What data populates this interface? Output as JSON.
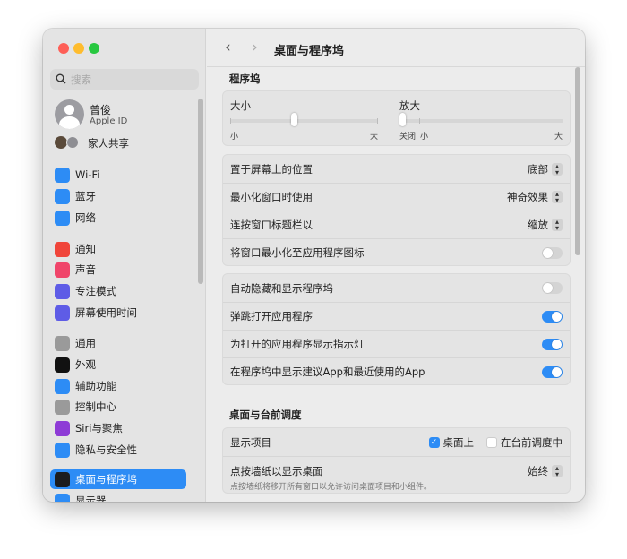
{
  "window": {
    "title": "桌面与程序坞"
  },
  "sidebar": {
    "search_placeholder": "搜索",
    "profile": {
      "name": "曾俊",
      "sub": "Apple ID"
    },
    "family": "家人共享",
    "items": [
      {
        "label": "Wi-Fi",
        "icon": "wifi-icon",
        "color": "#2d8cf5"
      },
      {
        "label": "蓝牙",
        "icon": "bluetooth-icon",
        "color": "#2d8cf5"
      },
      {
        "label": "网络",
        "icon": "globe-icon",
        "color": "#2d8cf5"
      },
      {
        "label": "通知",
        "icon": "bell-icon",
        "color": "#f0453a"
      },
      {
        "label": "声音",
        "icon": "speaker-icon",
        "color": "#f0456a"
      },
      {
        "label": "专注模式",
        "icon": "moon-icon",
        "color": "#5e5ce6"
      },
      {
        "label": "屏幕使用时间",
        "icon": "hourglass-icon",
        "color": "#5e5ce6"
      },
      {
        "label": "通用",
        "icon": "gear-icon",
        "color": "#9a9a9a"
      },
      {
        "label": "外观",
        "icon": "appearance-icon",
        "color": "#111111"
      },
      {
        "label": "辅助功能",
        "icon": "accessibility-icon",
        "color": "#2d8cf5"
      },
      {
        "label": "控制中心",
        "icon": "control-center-icon",
        "color": "#9a9a9a"
      },
      {
        "label": "Siri与聚焦",
        "icon": "siri-icon",
        "color": "#8e3bd6"
      },
      {
        "label": "隐私与安全性",
        "icon": "hand-icon",
        "color": "#2d8cf5"
      },
      {
        "label": "桌面与程序坞",
        "icon": "dock-icon",
        "color": "#1c1c1e"
      },
      {
        "label": "显示器",
        "icon": "sun-icon",
        "color": "#2d8cf5"
      }
    ],
    "selected": "桌面与程序坞"
  },
  "dock": {
    "heading": "程序坞",
    "size": {
      "label": "大小",
      "min": "小",
      "max": "大",
      "value": 0.43
    },
    "magnify": {
      "label": "放大",
      "off": "关闭",
      "min": "小",
      "max": "大",
      "value": 0
    },
    "rows1": [
      {
        "label": "置于屏幕上的位置",
        "value": "底部"
      },
      {
        "label": "最小化窗口时使用",
        "value": "神奇效果"
      },
      {
        "label": "连按窗口标题栏以",
        "value": "缩放"
      },
      {
        "label": "将窗口最小化至应用程序图标",
        "toggle": false
      }
    ],
    "rows2": [
      {
        "label": "自动隐藏和显示程序坞",
        "toggle": false
      },
      {
        "label": "弹跳打开应用程序",
        "toggle": true
      },
      {
        "label": "为打开的应用程序显示指示灯",
        "toggle": true
      },
      {
        "label": "在程序坞中显示建议App和最近使用的App",
        "toggle": true
      }
    ]
  },
  "stage": {
    "heading": "桌面与台前调度",
    "show_items": "显示项目",
    "desktop": {
      "label": "桌面上",
      "checked": true
    },
    "stage_manager": {
      "label": "在台前调度中",
      "checked": false
    },
    "click_wallpaper": "点按墙纸以显示桌面",
    "click_wallpaper_desc": "点按墙纸将移开所有窗口以允许访问桌面项目和小组件。",
    "click_wallpaper_value": "始终"
  },
  "accent": "#2d8cf5"
}
